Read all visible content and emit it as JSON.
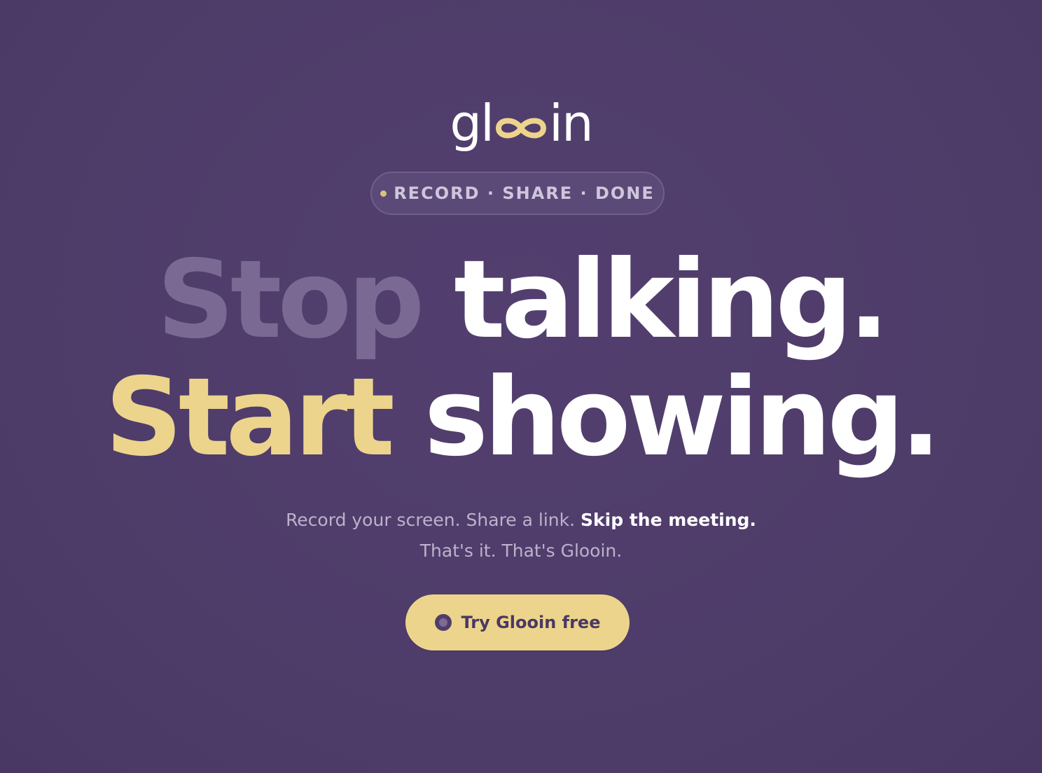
{
  "logo": {
    "prefix": "gl",
    "suffix": "in",
    "mark_icon": "infinity-loop-icon",
    "mark_color": "#ecd48c"
  },
  "badge": {
    "text": "RECORD · SHARE · DONE",
    "dot_color": "#d8c27f"
  },
  "headline": {
    "line1_dim": "Stop",
    "line1_bright": "talking.",
    "line2_accent": "Start",
    "line2_bright": "showing."
  },
  "subtext": {
    "line1_regular": "Record your screen. Share a link.",
    "line1_bold": "Skip the meeting.",
    "line2": "That's it. That's Glooin."
  },
  "cta": {
    "label": "Try Glooin free",
    "icon": "record-icon"
  },
  "colors": {
    "background": "#4f3d6b",
    "accent": "#ecd48c",
    "dim_text": "#7a6a93",
    "muted_text": "#bdb2cc"
  }
}
